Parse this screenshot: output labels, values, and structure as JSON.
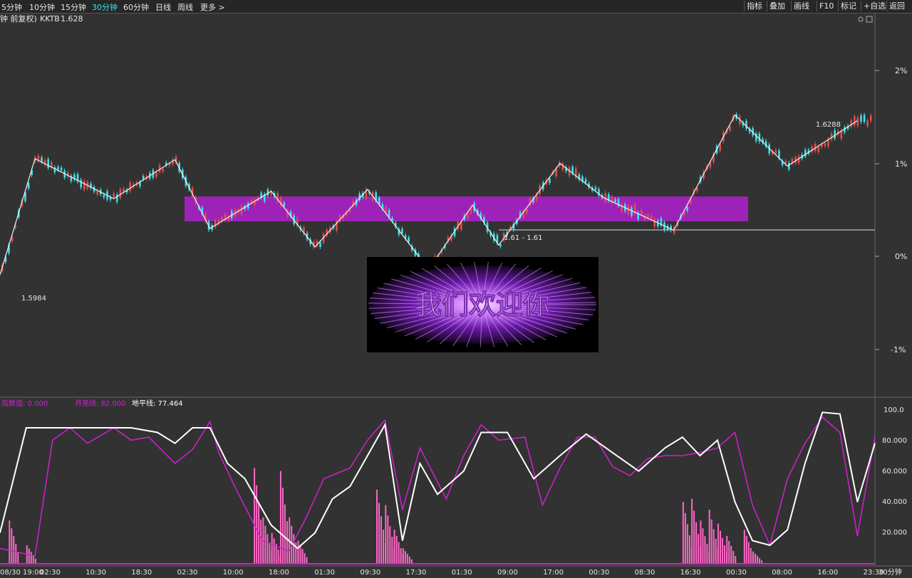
{
  "toolbar": {
    "periods": [
      "5分钟",
      "10分钟",
      "15分钟",
      "30分钟",
      "60分钟",
      "日线",
      "周线",
      "更多 >"
    ],
    "active_period": "30分钟",
    "right_buttons": [
      "指标",
      "叠加",
      "画线",
      "F10",
      "标记",
      "+自选",
      "返回"
    ]
  },
  "header": {
    "prefix": "钟 前复权)",
    "symbol": "KKTB",
    "price": "1.628"
  },
  "bottom": {
    "date_label": "08/30 19:00",
    "time_labels": [
      "02:30",
      "10:30",
      "18:30",
      "02:30",
      "10:00",
      "18:00",
      "01:30",
      "09:30",
      "17:30",
      "01:30",
      "09:00",
      "17:00",
      "00:30",
      "08:30",
      "16:30",
      "00:30",
      "08:00",
      "16:00",
      "23:30"
    ],
    "period_label": "30分钟"
  },
  "indicator": {
    "label1": "指数值: 0.000",
    "label2": "月亮线: 82.000",
    "label3": "地平线: 77.464",
    "ticks": [
      "100.0",
      "80.000",
      "60.000",
      "40.000",
      "20.000"
    ]
  },
  "price_axis": {
    "ticks": [
      "2%",
      "1%",
      "0%",
      "-1%"
    ]
  },
  "annotations": {
    "low1": "1.5984",
    "mid": "1.61 - 1.61",
    "high": "1.6288"
  },
  "overlay": {
    "text": "我们欢迎你"
  },
  "colors": {
    "up": "#e04f4f",
    "down": "#40e0e6",
    "zone": "#c020e0",
    "moon": "#d020d0",
    "horizon": "#ffffff",
    "hist": "#ff66c8"
  },
  "chart_data": [
    {
      "type": "line",
      "title": "KKTB",
      "y_unit": "% change",
      "ylim": [
        -1.4,
        2.4
      ],
      "x_range": [
        0,
        100
      ],
      "series": [
        {
          "name": "",
          "x": [
            0,
            4,
            13,
            20,
            24,
            31,
            36,
            42,
            49,
            54,
            57,
            64,
            69,
            77,
            84,
            90,
            98
          ],
          "values": [
            -0.2,
            1.05,
            0.62,
            1.04,
            0.3,
            0.7,
            0.1,
            0.72,
            -0.14,
            0.55,
            0.12,
            1.0,
            0.63,
            0.28,
            1.52,
            0.97,
            1.46
          ]
        }
      ],
      "annotations": [
        "1.5984",
        "1.61 - 1.61",
        "1.6288"
      ]
    },
    {
      "type": "line",
      "ylim": [
        0,
        100
      ],
      "x_range": [
        0,
        100
      ],
      "series": [
        {
          "name": "月亮线",
          "x": [
            0,
            4,
            6,
            8,
            10,
            13,
            15,
            17,
            20,
            22,
            24,
            25,
            27,
            30,
            33,
            35,
            37,
            40,
            42,
            44,
            46,
            48,
            51,
            53,
            55,
            57,
            60,
            62,
            64,
            66,
            68,
            70,
            72,
            74,
            76,
            78,
            80,
            82,
            84,
            86,
            88,
            90,
            92,
            94,
            96,
            98,
            100
          ],
          "values": [
            10,
            5,
            80,
            88,
            78,
            88,
            80,
            82,
            65,
            74,
            92,
            72,
            48,
            15,
            8,
            30,
            55,
            62,
            80,
            93,
            35,
            75,
            42,
            70,
            90,
            80,
            82,
            38,
            62,
            82,
            82,
            63,
            57,
            68,
            70,
            70,
            72,
            75,
            85,
            38,
            12,
            55,
            78,
            95,
            85,
            18,
            82
          ]
        },
        {
          "name": "地平线",
          "x": [
            0,
            3,
            6,
            9,
            12,
            15,
            18,
            20,
            22,
            24,
            26,
            28,
            31,
            34,
            36,
            38,
            40,
            42,
            44,
            46,
            48,
            50,
            53,
            55,
            58,
            61,
            64,
            67,
            70,
            73,
            76,
            78,
            80,
            82,
            84,
            86,
            88,
            90,
            92,
            94,
            96,
            98,
            100
          ],
          "values": [
            20,
            88,
            88,
            88,
            88,
            88,
            85,
            78,
            88,
            88,
            65,
            55,
            25,
            10,
            20,
            42,
            50,
            70,
            90,
            15,
            65,
            45,
            60,
            85,
            85,
            55,
            70,
            84,
            72,
            60,
            75,
            82,
            70,
            80,
            40,
            15,
            12,
            22,
            65,
            98,
            97,
            40,
            78
          ]
        },
        {
          "name": "指数值",
          "type": "bar",
          "x": [
            1,
            3,
            29,
            30,
            31,
            32,
            33,
            34,
            43,
            44,
            45,
            46,
            78,
            79,
            80,
            81,
            82,
            83,
            85,
            86
          ],
          "values": [
            28,
            12,
            62,
            30,
            20,
            60,
            30,
            15,
            48,
            38,
            22,
            10,
            40,
            42,
            28,
            35,
            26,
            18,
            22,
            8
          ]
        }
      ],
      "ticks": [
        "100.0",
        "80.000",
        "60.000",
        "40.000",
        "20.000"
      ]
    }
  ]
}
